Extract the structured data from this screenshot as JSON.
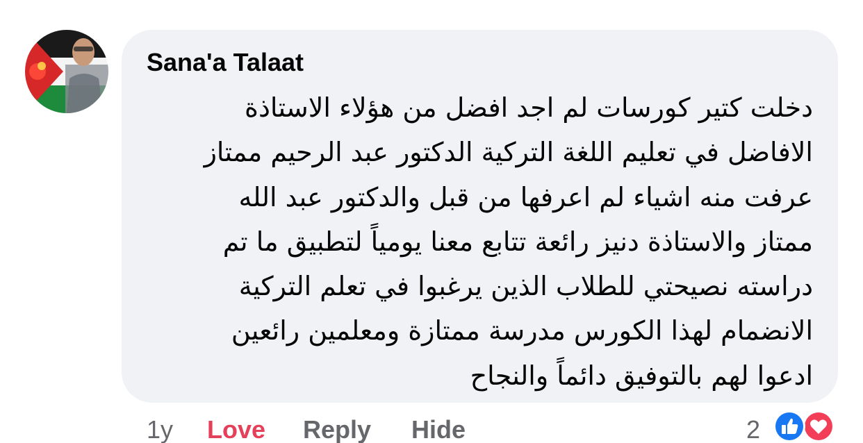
{
  "comment": {
    "author": "Sana'a Talaat",
    "lines": [
      "دخلت كتير كورسات لم اجد افضل من هؤلاء الاستاذة",
      "الافاضل في تعليم اللغة التركية الدكتور عبد الرحيم ممتاز",
      "عرفت منه اشياء لم اعرفها من قبل والدكتور عبد الله",
      "ممتاز  والاستاذة دنيز رائعة تتابع معنا يومياً لتطبيق ما تم",
      "دراسته نصيحتي للطلاب الذين يرغبوا في تعلم التركية",
      "الانضمام لهذا الكورس مدرسة ممتازة ومعلمين رائعين",
      "ادعوا لهم بالتوفيق دائماً والنجاح"
    ]
  },
  "actions": {
    "age": "1y",
    "love": "Love",
    "reply": "Reply",
    "hide": "Hide"
  },
  "reactions": {
    "count": "2",
    "icons": [
      "like-icon",
      "love-icon"
    ]
  },
  "colors": {
    "bubble": "#f0f2f5",
    "love": "#e4405a",
    "meta": "#65676b",
    "like_blue": "#1877f2",
    "love_red": "#f33e58"
  }
}
